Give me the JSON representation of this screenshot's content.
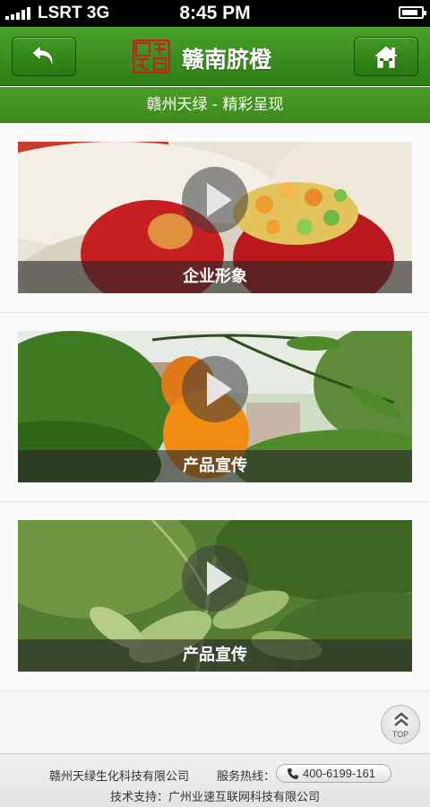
{
  "status_bar": {
    "carrier": "LSRT 3G",
    "time": "8:45 PM",
    "signal_bars": 5,
    "battery_level": 0.85
  },
  "header": {
    "title": "赣南脐橙",
    "back_icon": "back-arrow-icon",
    "home_icon": "home-icon",
    "logo_icon": "red-seal-logo",
    "accent_color": "#3a8e1c"
  },
  "sub_header": {
    "text": "赣州天绿 - 精彩呈现"
  },
  "videos": [
    {
      "caption": "企业形象",
      "icon": "play-icon",
      "scene": "apple-salad"
    },
    {
      "caption": "产品宣传",
      "icon": "play-icon",
      "scene": "orange-tree"
    },
    {
      "caption": "产品宣传",
      "icon": "play-icon",
      "scene": "tea-leaves"
    }
  ],
  "top_button": {
    "label": "TOP",
    "icon": "double-chevron-up-icon"
  },
  "footer": {
    "company": "赣州天绿生化科技有限公司",
    "hotline_label": "服务热线：",
    "hotline_number": "400-6199-161",
    "phone_icon": "phone-icon",
    "tech_support": "技术支持：广州业速互联网科技有限公司"
  }
}
